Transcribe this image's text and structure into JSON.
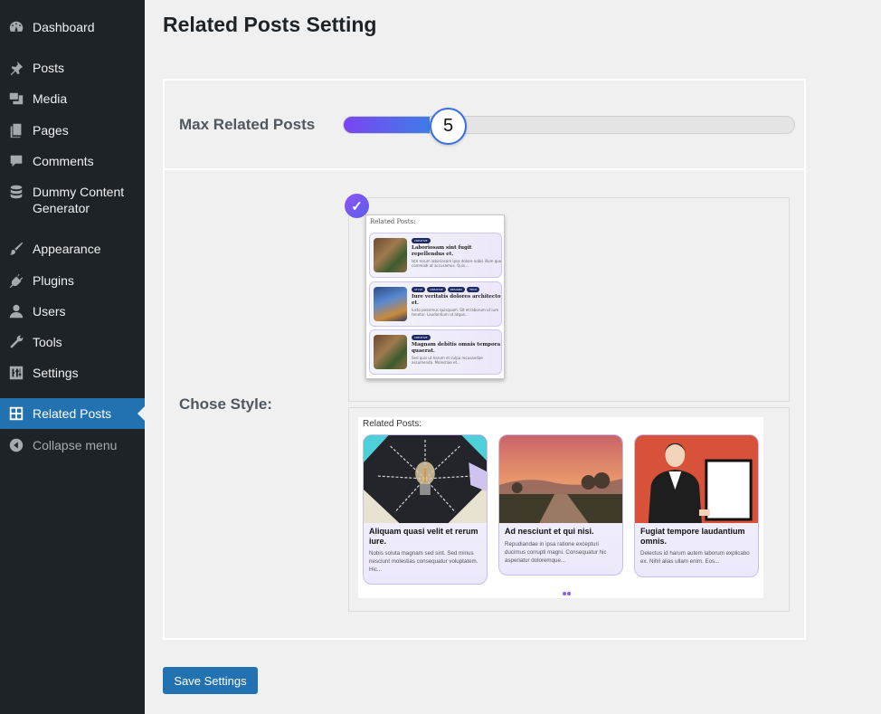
{
  "sidebar": {
    "items": [
      {
        "label": "Dashboard",
        "icon": "dashboard-icon"
      },
      {
        "label": "Posts",
        "icon": "pin-icon"
      },
      {
        "label": "Media",
        "icon": "media-icon"
      },
      {
        "label": "Pages",
        "icon": "pages-icon"
      },
      {
        "label": "Comments",
        "icon": "comment-icon"
      },
      {
        "label": "Dummy Content Generator",
        "icon": "database-icon"
      },
      {
        "label": "Appearance",
        "icon": "brush-icon"
      },
      {
        "label": "Plugins",
        "icon": "plugin-icon"
      },
      {
        "label": "Users",
        "icon": "user-icon"
      },
      {
        "label": "Tools",
        "icon": "wrench-icon"
      },
      {
        "label": "Settings",
        "icon": "settings-icon"
      },
      {
        "label": "Related Posts",
        "icon": "grid-icon",
        "active": true
      },
      {
        "label": "Collapse menu",
        "icon": "collapse-icon"
      }
    ]
  },
  "page": {
    "title": "Related Posts Setting"
  },
  "settings": {
    "max_label": "Max Related Posts",
    "max_value": "5",
    "max_fraction": 0.19,
    "style_label": "Chose Style:",
    "selected_style": 1
  },
  "preview1": {
    "title": "Related Posts:",
    "cards": [
      {
        "tags": [
          "CREATIVE"
        ],
        "title": "Laboriosam sint fugit repellendus et.",
        "text": "Iste rerum laboriosam ipsa dolore nobis illum quo commodi at accusamus. Quis..."
      },
      {
        "tags": [
          "STYLE",
          "CREATIVE",
          "DESIGNS",
          "TECH"
        ],
        "title": "Iure veritatis dolores architecto et.",
        "text": "Iusto possimus quisquam. Sit et laborum ut iure tenetur. Laudantium ut atque..."
      },
      {
        "tags": [
          "CREATIVE"
        ],
        "title": "Magnam debitis omnis tempora quaerat.",
        "text": "Sed quis ut harum et culpa recusandae assumenda. Molestiae et..."
      }
    ]
  },
  "preview2": {
    "title": "Related Posts:",
    "cards": [
      {
        "title": "Aliquam quasi velit et rerum iure.",
        "text": "Nobis soluta magnam sed sint. Sed minus nesciunt molestias consequatur voluptatem. Hic..."
      },
      {
        "title": "Ad nesciunt et qui nisi.",
        "text": "Repudiandae in ipsa ratione excepturi ducimus corrupti magni. Consequatur hic asperiatur doloremque..."
      },
      {
        "title": "Fugiat tempore laudantium omnis.",
        "text": "Delectus id harum autem laborum explicabo ex. Nihil alias ullam enim. Eos..."
      }
    ]
  },
  "actions": {
    "save_label": "Save Settings"
  },
  "colors": {
    "sidebar_bg": "#1d2327",
    "active_item": "#2271b1",
    "slider_fill_start": "#7b45f0",
    "slider_fill_end": "#3f7ce8",
    "check_badge": "#8e54f5"
  }
}
